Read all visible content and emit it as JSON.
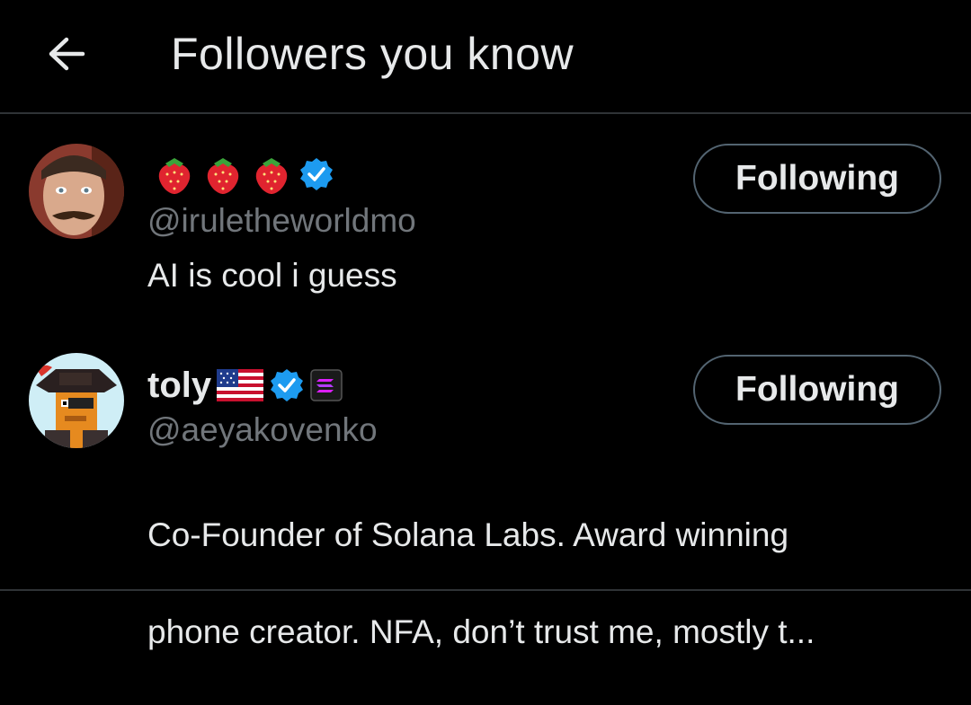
{
  "header": {
    "back_icon": "arrow-left-icon",
    "title": "Followers you know"
  },
  "users": [
    {
      "display_name": "",
      "name_emojis": [
        "strawberry-icon",
        "strawberry-icon",
        "strawberry-icon"
      ],
      "verified_icon": "verified-badge-icon",
      "handle": "@iruletheworldmo",
      "bio": "AI is cool i guess",
      "follow_label": "Following"
    },
    {
      "display_name": "toly",
      "name_emojis": [
        "us-flag-icon"
      ],
      "verified_icon": "verified-badge-icon",
      "affiliate_icon": "solana-logo-icon",
      "handle": "@aeyakovenko",
      "bio": "Co-Founder of Solana Labs. Award winning phone creator. NFA, don’t trust me, mostly t...",
      "bio_line1": "Co-Founder of Solana Labs. Award winning",
      "bio_line2": "phone creator. NFA, don’t trust me, mostly t...",
      "follow_label": "Following"
    }
  ],
  "colors": {
    "background": "#000000",
    "text_primary": "#e7e9ea",
    "text_secondary": "#71767b",
    "verified_blue": "#1d9bf0",
    "divider": "#2f3336"
  }
}
